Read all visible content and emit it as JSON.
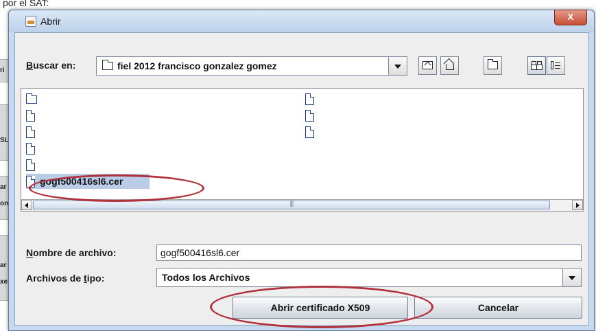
{
  "background": {
    "top_text": "por el SAT:",
    "fragments": [
      "ri",
      "SL",
      "ar",
      "on",
      "ar",
      "xe"
    ]
  },
  "dialog": {
    "title": "Abrir",
    "close_label": "X",
    "look_in": {
      "label_prefix": "",
      "label_mnemonic": "B",
      "label_rest": "uscar en:",
      "value": "fiel 2012 francisco gonzalez gomez"
    },
    "toolbar_icons": [
      "up-one-level-icon",
      "home-icon",
      "new-folder-icon",
      "list-view-icon",
      "details-view-icon"
    ],
    "files": {
      "col1": [
        {
          "type": "folder",
          "name": ""
        },
        {
          "type": "file",
          "name": ""
        },
        {
          "type": "file",
          "name": ""
        },
        {
          "type": "file",
          "name": ""
        },
        {
          "type": "file",
          "name": ""
        },
        {
          "type": "file",
          "name": "gogf500416sl6.cer",
          "selected": true
        }
      ],
      "col2": [
        {
          "type": "file",
          "name": ""
        },
        {
          "type": "file",
          "name": ""
        },
        {
          "type": "file",
          "name": ""
        }
      ]
    },
    "file_name": {
      "label_mnemonic": "N",
      "label_rest": "ombre de archivo:",
      "value": "gogf500416sl6.cer"
    },
    "file_type": {
      "label_prefix": "Archivos de ",
      "label_mnemonic": "t",
      "label_rest": "ipo:",
      "value": "Todos los Archivos"
    },
    "open_button": "Abrir certificado X509",
    "cancel_button": "Cancelar"
  },
  "colors": {
    "annotation": "#b0323d",
    "selection": "#b9cde6",
    "window_frame": "#c7d9ee"
  }
}
